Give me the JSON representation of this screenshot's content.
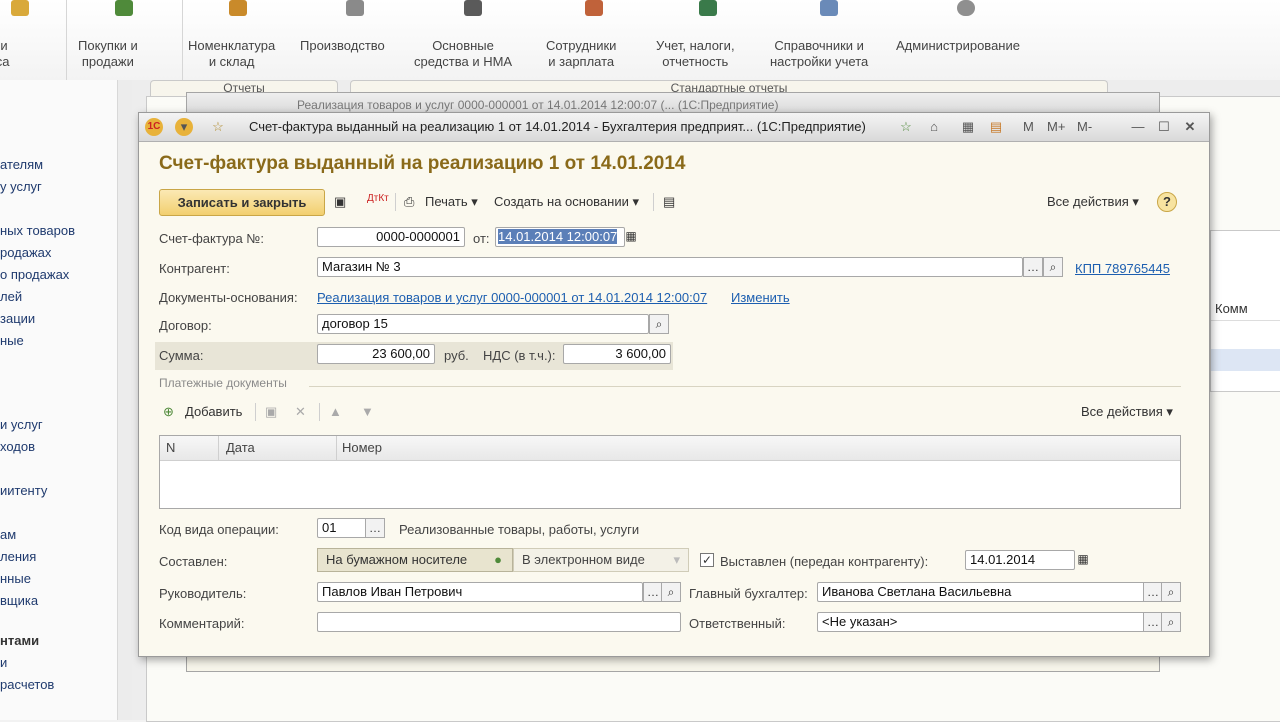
{
  "sections": [
    {
      "label": "нк и\nасса",
      "icon": "bank-icon"
    },
    {
      "label": "Покупки и\nпродажи",
      "icon": "cart-icon"
    },
    {
      "label": "Номенклатура\nи склад",
      "icon": "warehouse-icon"
    },
    {
      "label": "Производство",
      "icon": "factory-icon"
    },
    {
      "label": "Основные\nсредства и НМА",
      "icon": "truck-icon"
    },
    {
      "label": "Сотрудники\nи зарплата",
      "icon": "people-icon"
    },
    {
      "label": "Учет, налоги,\nотчетность",
      "icon": "ledger-icon"
    },
    {
      "label": "Справочники и\nнастройки учета",
      "icon": "book-icon"
    },
    {
      "label": "Администрирование",
      "icon": "gear-icon"
    }
  ],
  "left_nav": [
    "ателям",
    "у услуг",
    "ных товаров",
    "родажах",
    "о продажах",
    "лей",
    "зации",
    "ные",
    "и услуг",
    "ходов",
    "иитенту",
    "ам",
    "ления",
    "нные",
    "вщика",
    "нтами",
    "и",
    "расчетов"
  ],
  "background": {
    "tab1": "Отчеты",
    "tab2": "Стандартные отчеты",
    "back_title": "Реализация товаров и услуг 0000-000001 от 14.01.2014 12:00:07 (... (1С:Предприятие)",
    "column": "Комм"
  },
  "window": {
    "title": "Счет-фактура выданный на реализацию 1 от 14.01.2014 - Бухгалтерия предприят... (1С:Предприятие)",
    "mem_buttons": [
      "M",
      "M+",
      "M-"
    ]
  },
  "heading": "Счет-фактура выданный на реализацию 1 от 14.01.2014",
  "toolbar": {
    "save_close": "Записать и закрыть",
    "print": "Печать",
    "create_based": "Создать на основании",
    "all_actions": "Все действия",
    "help": "?"
  },
  "form": {
    "invoice_label": "Счет-фактура №:",
    "invoice_number": "0000-0000001",
    "from_label": "от:",
    "invoice_date": "14.01.2014 12:00:07",
    "counterparty_label": "Контрагент:",
    "counterparty": "Магазин № 3",
    "kpp_link": "КПП 789765445",
    "base_docs_label": "Документы-основания:",
    "base_doc_link": "Реализация товаров и услуг 0000-000001 от 14.01.2014 12:00:07",
    "change_link": "Изменить",
    "contract_label": "Договор:",
    "contract": "договор 15",
    "sum_label": "Сумма:",
    "sum": "23 600,00",
    "currency": "руб.",
    "vat_label": "НДС (в т.ч.):",
    "vat": "3 600,00"
  },
  "payments": {
    "title": "Платежные документы",
    "add": "Добавить",
    "all_actions": "Все действия",
    "columns": [
      "N",
      "Дата",
      "Номер"
    ]
  },
  "bottom": {
    "op_code_label": "Код вида операции:",
    "op_code": "01",
    "op_code_desc": "Реализованные товары, работы, услуги",
    "composed_label": "Составлен:",
    "paper": "На бумажном носителе",
    "electronic": "В электронном виде",
    "issued_label": "Выставлен (передан контрагенту):",
    "issued_date": "14.01.2014",
    "manager_label": "Руководитель:",
    "manager": "Павлов Иван Петрович",
    "accountant_label": "Главный бухгалтер:",
    "accountant": "Иванова Светлана Васильевна",
    "comment_label": "Комментарий:",
    "comment": "",
    "responsible_label": "Ответственный:",
    "responsible": "<Не указан>"
  },
  "colors": {
    "accent": "#8a6a1a",
    "link": "#1d5fb0",
    "primary_button": "#f2cf6f"
  }
}
